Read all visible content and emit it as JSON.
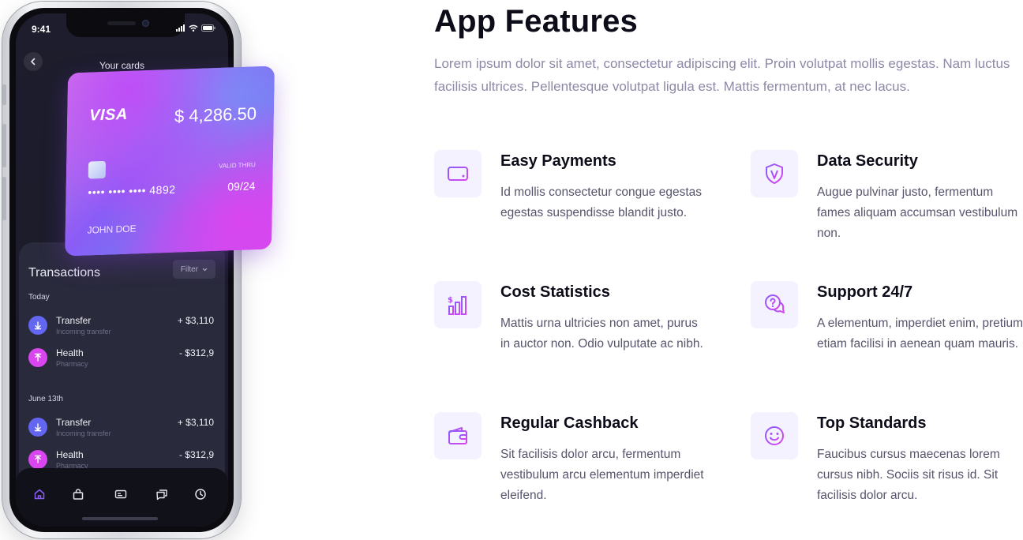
{
  "phone": {
    "status_time": "9:41",
    "screen_title": "Your cards",
    "card": {
      "brand": "VISA",
      "balance": "$ 4,286.50",
      "valid_label": "VALID THRU",
      "number": "•••• •••• •••• 4892",
      "expiry": "09/24",
      "holder": "JOHN DOE"
    },
    "transactions": {
      "title": "Transactions",
      "filter_label": "Filter",
      "groups": [
        {
          "label": "Today",
          "items": [
            {
              "name": "Transfer",
              "sub": "Incoming transfer",
              "amount": "+ $3,110",
              "kind": "in"
            },
            {
              "name": "Health",
              "sub": "Pharmacy",
              "amount": "- $312,9",
              "kind": "out"
            }
          ]
        },
        {
          "label": "June 13th",
          "items": [
            {
              "name": "Transfer",
              "sub": "Incoming transfer",
              "amount": "+ $3,110",
              "kind": "in"
            },
            {
              "name": "Health",
              "sub": "Pharmacy",
              "amount": "- $312,9",
              "kind": "out"
            }
          ]
        }
      ]
    },
    "tab_bar": [
      "home-icon",
      "bag-icon",
      "card-icon",
      "chat-icon",
      "clock-icon"
    ],
    "colors": {
      "active_tab": "#8b5cf6",
      "incoming": "#6366f1",
      "outgoing": "#d946ef"
    }
  },
  "section": {
    "title": "App Features",
    "description": "Lorem ipsum dolor sit amet, consectetur adipiscing elit. Proin volutpat mollis egestas. Nam luctus facilisis ultrices. Pellentesque volutpat ligula est. Mattis fermentum, at nec lacus."
  },
  "features": [
    {
      "icon": "payment-card-icon",
      "title": "Easy Payments",
      "desc": "Id mollis consectetur congue egestas egestas suspendisse blandit justo."
    },
    {
      "icon": "shield-icon",
      "title": "Data Security",
      "desc": "Augue pulvinar justo, fermentum fames aliquam accumsan vestibulum non."
    },
    {
      "icon": "statistics-icon",
      "title": "Cost Statistics",
      "desc": "Mattis urna ultricies non amet, purus in auctor non. Odio vulputate ac nibh."
    },
    {
      "icon": "support-chat-icon",
      "title": "Support 24/7",
      "desc": "A elementum, imperdiet enim, pretium etiam facilisi in aenean quam mauris."
    },
    {
      "icon": "wallet-icon",
      "title": "Regular Cashback",
      "desc": "Sit facilisis dolor arcu, fermentum vestibulum arcu elementum imperdiet eleifend."
    },
    {
      "icon": "smile-icon",
      "title": "Top Standards",
      "desc": "Faucibus cursus maecenas lorem cursus nibh. Sociis sit risus id. Sit facilisis dolor arcu."
    }
  ],
  "accent_gradient": [
    "#8b5cf6",
    "#d946ef"
  ]
}
